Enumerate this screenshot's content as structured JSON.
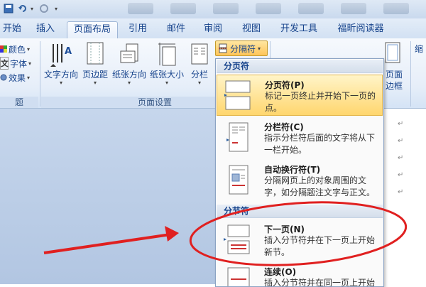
{
  "tabs": [
    {
      "label": "开始"
    },
    {
      "label": "插入"
    },
    {
      "label": "页面布局"
    },
    {
      "label": "引用"
    },
    {
      "label": "邮件"
    },
    {
      "label": "审阅"
    },
    {
      "label": "视图"
    },
    {
      "label": "开发工具"
    },
    {
      "label": "福昕阅读器"
    }
  ],
  "ribbon": {
    "theme_group": {
      "colors": "颜色",
      "fonts": "字体",
      "effects": "效果",
      "group_label_fragment": "题"
    },
    "page_setup": {
      "text_direction": "文字方向",
      "margins": "页边距",
      "orientation": "纸张方向",
      "size": "纸张大小",
      "columns": "分栏",
      "breaks_button": "分隔符",
      "group_label": "页面设置"
    },
    "page_background": {
      "page_borders_line1": "页面",
      "page_borders_line2": "边框"
    },
    "right_fragment": "缩"
  },
  "menu": {
    "section_page_breaks": "分页符",
    "section_section_breaks": "分节符",
    "items": [
      {
        "title": "分页符(P)",
        "desc": "标记一页终止并开始下一页的点。",
        "highlighted": true
      },
      {
        "title": "分栏符(C)",
        "desc": "指示分栏符后面的文字将从下一栏开始。"
      },
      {
        "title": "自动换行符(T)",
        "desc": "分隔网页上的对象周围的文字，如分隔题注文字与正文。"
      },
      {
        "title": "下一页(N)",
        "desc": "插入分节符并在下一页上开始新节。"
      },
      {
        "title": "连续(O)",
        "desc": "插入分节符并在同一页上开始"
      }
    ]
  },
  "paragraph_mark": "↵",
  "colors": {
    "annotation_red": "#e02020",
    "highlight": "#ffd66e",
    "ribbon_text": "#15428b"
  }
}
